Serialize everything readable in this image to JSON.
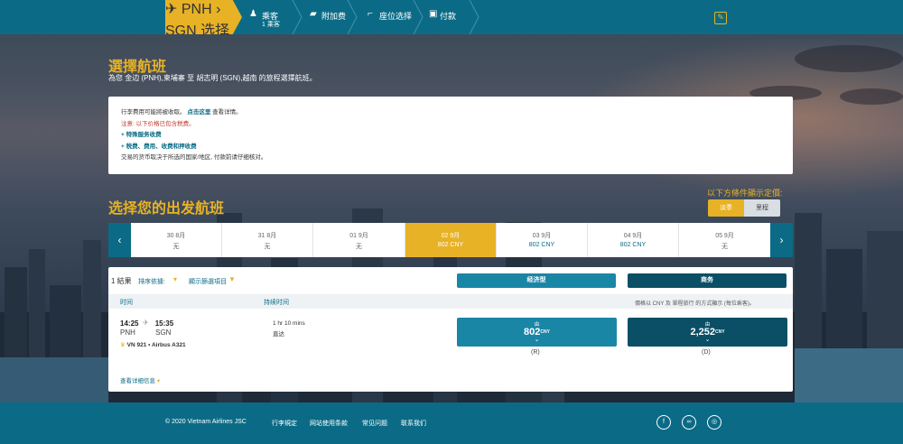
{
  "nav": {
    "steps": [
      {
        "label": "PNH",
        "label2": "SGN",
        "sub": "选择航班"
      },
      {
        "label": "乘客",
        "sub": "1 乘客"
      },
      {
        "label": "附加费",
        "sub": ""
      },
      {
        "label": "座位选择",
        "sub": ""
      },
      {
        "label": "付款",
        "sub": ""
      }
    ],
    "edit_icon": "pencil-icon"
  },
  "page": {
    "title": "選擇航班",
    "subtitle": "為您 金边 (PNH),柬埔寨 至 胡志明 (SGN),越南 的旅程選擇航班。"
  },
  "info": {
    "line1_prefix": "行李費用可能將被收取。",
    "line1_link": "点击这里",
    "line1_suffix": "查看详情。",
    "line2": "注意: 以下价格已包含税费。",
    "line3": "+ 特殊服务收费",
    "line4": "+ 税费、费用、收费和押收费",
    "line5": "交易的货币取决于所选的国家/地区, 付款前请仔细核对。"
  },
  "outbound": {
    "title": "选择您的出发航班",
    "price_note": "以下方條件顯示定價:",
    "toggle_on": "淡季",
    "toggle_off": "里程"
  },
  "dates": [
    {
      "date": "30 8月",
      "price": "无"
    },
    {
      "date": "31 8月",
      "price": "无"
    },
    {
      "date": "01 9月",
      "price": "无"
    },
    {
      "date": "02 9月",
      "price": "802 CNY"
    },
    {
      "date": "03 9月",
      "price": "802 CNY"
    },
    {
      "date": "04 9月",
      "price": "802 CNY"
    },
    {
      "date": "05 9月",
      "price": "无"
    }
  ],
  "results": {
    "count": "1 結果",
    "sort_label": "排序依據:",
    "filter_label": "顯示篩選項目",
    "economy_label": "经济型",
    "business_label": "商务",
    "col_time": "时间",
    "col_duration": "持续时间",
    "currency_note": "價格以 CNY 及 單程旅行 的方式顯示 (每位乘客)。",
    "flight": {
      "depart_time": "14:25",
      "arrive_time": "15:35",
      "from": "PNH",
      "to": "SGN",
      "number": "VN 921",
      "aircraft": "Airbus A321",
      "duration": "1 hr 10 mins",
      "stops": "直达",
      "details_link": "查看详细信息"
    },
    "fares": [
      {
        "from": "由",
        "amount": "802",
        "currency": "CNY",
        "class": "(R)"
      },
      {
        "from": "由",
        "amount": "2,252",
        "currency": "CNY",
        "class": "(D)"
      }
    ]
  },
  "footer": {
    "copyright": "© 2020 Vietnam Airlines JSC",
    "links": [
      "行李規定",
      "网站使用条款",
      "常见问题",
      "联系我们"
    ]
  },
  "colors": {
    "primary": "#0b6b86",
    "accent": "#e8b226",
    "business": "#0a4f66"
  }
}
